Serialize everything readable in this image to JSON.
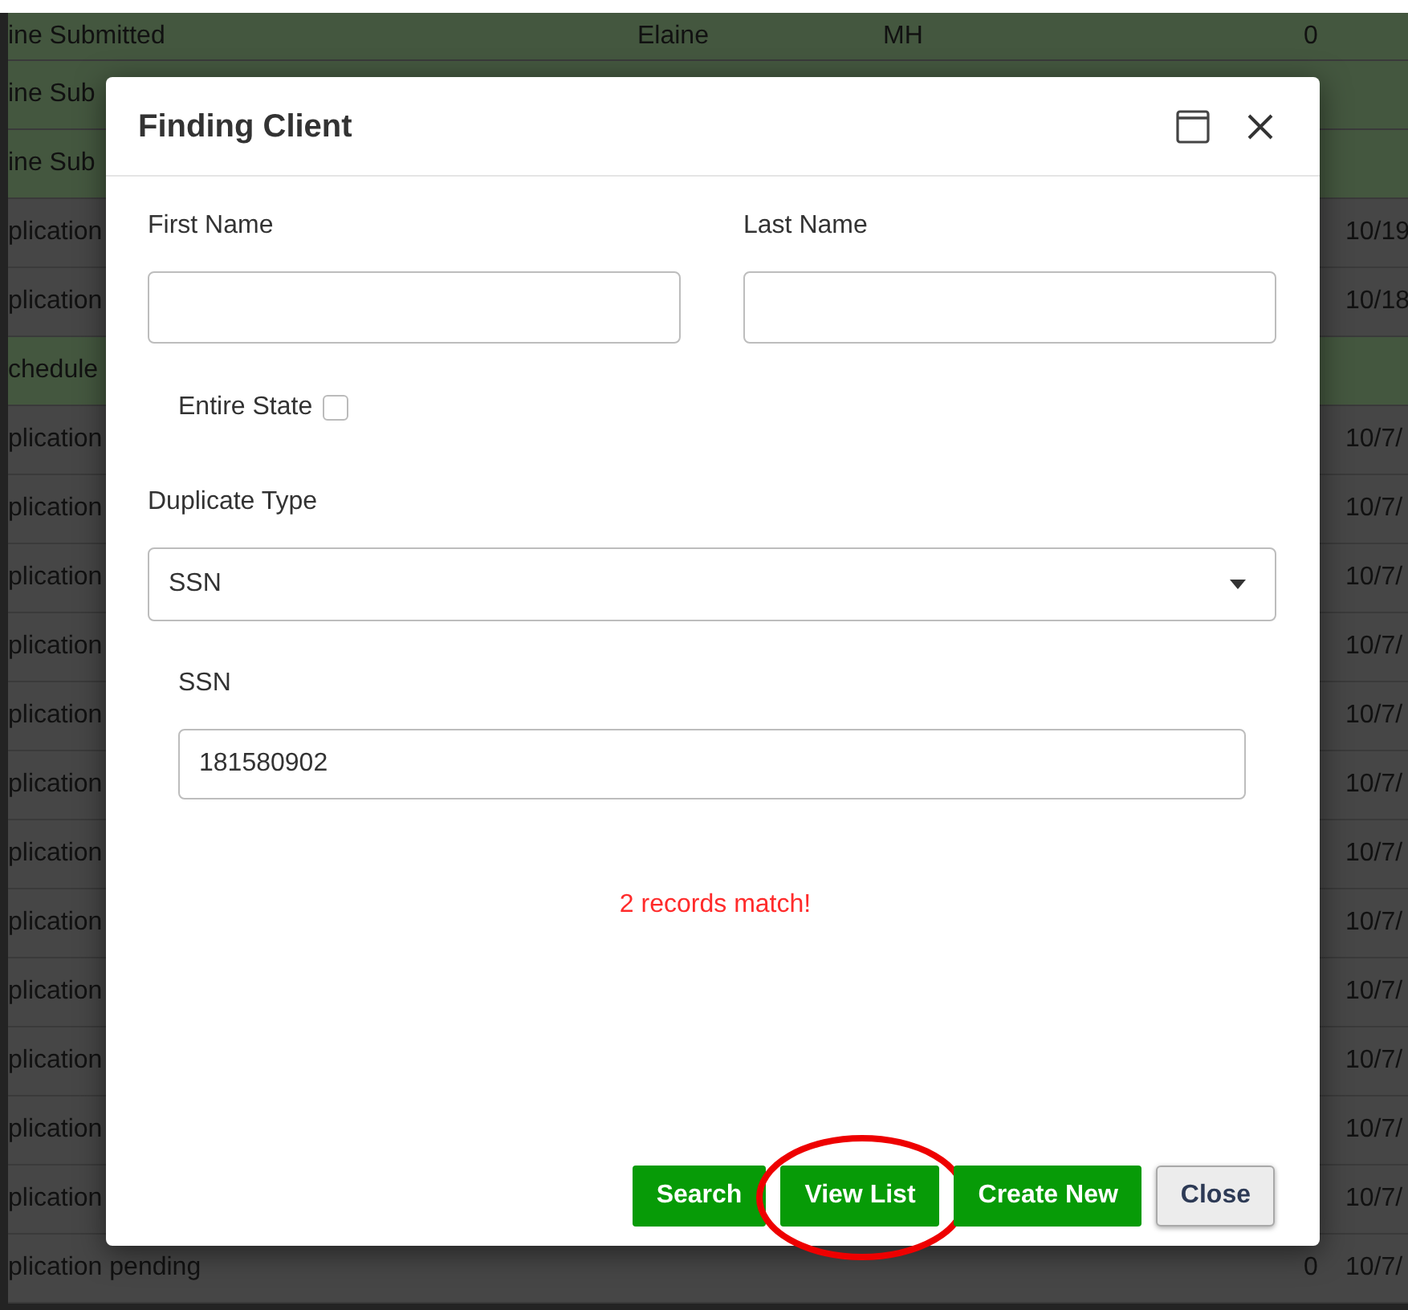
{
  "background_table": {
    "rows": [
      {
        "column_1": "ine Submitted",
        "column_2": "Elaine",
        "column_3": "MH",
        "column_4": "0",
        "highlighted": true
      },
      {
        "column_1": "ine Sub",
        "highlighted": true
      },
      {
        "column_1": "ine Sub",
        "highlighted": true
      },
      {
        "column_1": "plication",
        "column_5": "10/19",
        "highlighted": false
      },
      {
        "column_1": "plication",
        "column_5": "10/18",
        "highlighted": false
      },
      {
        "column_1": "chedule",
        "highlighted": true
      },
      {
        "column_1": "plication",
        "column_5": "10/7/",
        "highlighted": false
      },
      {
        "column_1": "plication",
        "column_5": "10/7/",
        "highlighted": false
      },
      {
        "column_1": "plication",
        "column_5": "10/7/",
        "highlighted": false
      },
      {
        "column_1": "plication",
        "column_5": "10/7/",
        "highlighted": false
      },
      {
        "column_1": "plication",
        "column_5": "10/7/",
        "highlighted": false
      },
      {
        "column_1": "plication",
        "column_5": "10/7/",
        "highlighted": false
      },
      {
        "column_1": "plication",
        "column_5": "10/7/",
        "highlighted": false
      },
      {
        "column_1": "plication",
        "column_5": "10/7/",
        "highlighted": false
      },
      {
        "column_1": "plication",
        "column_5": "10/7/",
        "highlighted": false
      },
      {
        "column_1": "plication",
        "column_5": "10/7/",
        "highlighted": false
      },
      {
        "column_1": "plication",
        "column_5": "10/7/",
        "highlighted": false
      },
      {
        "column_1": "plication",
        "column_5": "10/7/",
        "highlighted": false
      },
      {
        "column_1": "plication pending",
        "column_4": "0",
        "column_5": "10/7/",
        "highlighted": false
      }
    ]
  },
  "dialog": {
    "title": "Finding Client",
    "first_name": {
      "label": "First Name"
    },
    "last_name": {
      "label": "Last Name"
    },
    "entire_state": {
      "label": "Entire State",
      "checked": false
    },
    "duplicate_type": {
      "label": "Duplicate Type",
      "value": "SSN"
    },
    "ssn": {
      "label": "SSN",
      "value": "181580902"
    },
    "message": "2 records match!",
    "buttons": [
      {
        "label": "Search",
        "kind": "primary",
        "circled": false
      },
      {
        "label": "View List",
        "kind": "primary",
        "circled": true
      },
      {
        "label": "Create New",
        "kind": "primary",
        "circled": false
      },
      {
        "label": "Close",
        "kind": "secondary",
        "circled": false
      }
    ]
  }
}
